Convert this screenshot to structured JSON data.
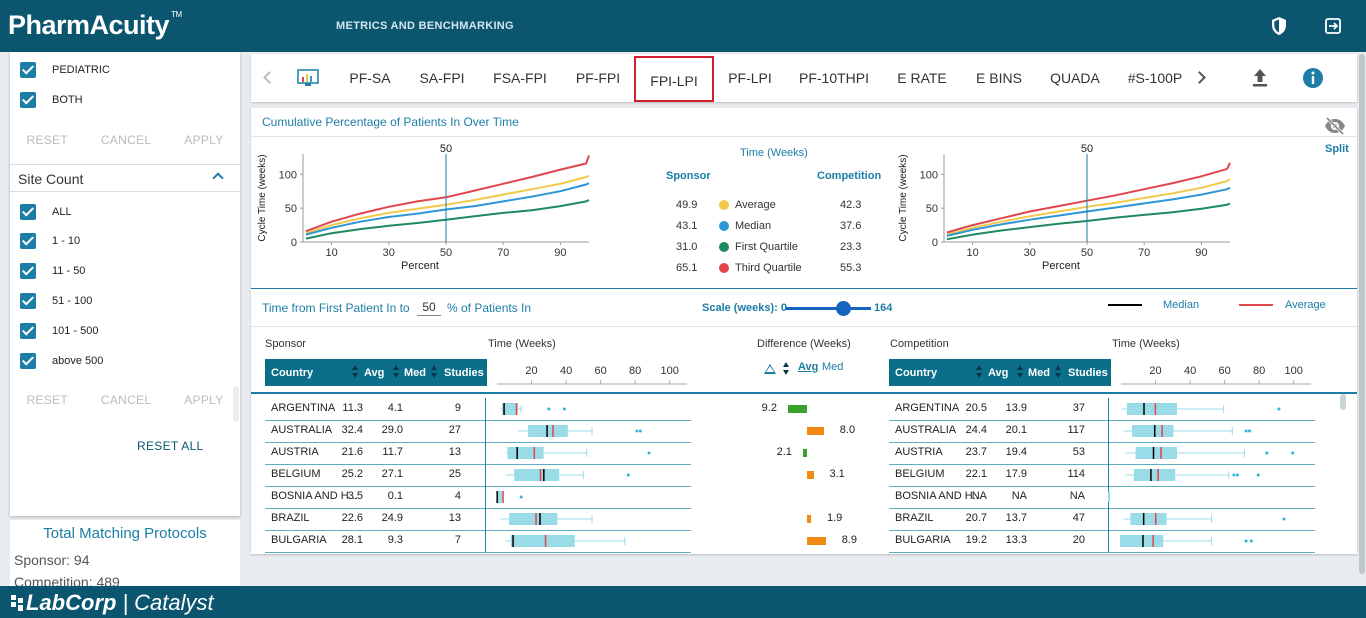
{
  "header": {
    "logo": "PharmAcuity",
    "logo_tm": "TM",
    "title": "METRICS AND BENCHMARKING",
    "icons": [
      "shield-icon",
      "logout-icon"
    ]
  },
  "sidebar": {
    "top_options": [
      {
        "label": "PEDIATRIC",
        "checked": true
      },
      {
        "label": "BOTH",
        "checked": true
      }
    ],
    "buttons": {
      "reset": "RESET",
      "cancel": "CANCEL",
      "apply": "APPLY"
    },
    "site_count": {
      "title": "Site Count",
      "options": [
        {
          "label": "ALL",
          "checked": true
        },
        {
          "label": "1 - 10",
          "checked": true
        },
        {
          "label": "11 - 50",
          "checked": true
        },
        {
          "label": "51 - 100",
          "checked": true
        },
        {
          "label": "101 - 500",
          "checked": true
        },
        {
          "label": "above 500",
          "checked": true
        }
      ]
    },
    "reset_all": "RESET ALL",
    "totals": {
      "title": "Total Matching Protocols",
      "sponsor": "Sponsor: 94",
      "competition": "Competition: 489"
    }
  },
  "tabs": {
    "items": [
      "PF-SA",
      "SA-FPI",
      "FSA-FPI",
      "PF-FPI",
      "FPI-LPI",
      "PF-LPI",
      "PF-10THPI",
      "E RATE",
      "E BINS",
      "QUADA",
      "#S-100P"
    ],
    "active": "FPI-LPI",
    "icons": [
      "chart-icon",
      "upload-icon",
      "info-icon"
    ]
  },
  "cumulative": {
    "title": "Cumulative Percentage of Patients In Over Time",
    "split_label": "Split",
    "legend_title": "Time (Weeks)",
    "sponsor_label": "Sponsor",
    "competition_label": "Competition",
    "legend": [
      {
        "name": "Average",
        "sponsor": "49.9",
        "competition": "42.3",
        "color": "#f1c94a"
      },
      {
        "name": "Median",
        "sponsor": "43.1",
        "competition": "37.6",
        "color": "#2f96d6"
      },
      {
        "name": "First Quartile",
        "sponsor": "31.0",
        "competition": "23.3",
        "color": "#1e8a5e"
      },
      {
        "name": "Third Quartile",
        "sponsor": "65.1",
        "competition": "55.3",
        "color": "#e0464c"
      }
    ]
  },
  "chart_data": [
    {
      "type": "line",
      "title": "",
      "xlabel": "Percent",
      "ylabel": "Cycle Time (weeks)",
      "x_ticks": [
        "10",
        "30",
        "50",
        "70",
        "90"
      ],
      "y_ticks": [
        "0",
        "50",
        "100"
      ],
      "xlim": [
        0,
        100
      ],
      "ylim": [
        0,
        130
      ],
      "marker": {
        "x": 50,
        "label": "50"
      },
      "x": [
        1,
        10,
        20,
        30,
        40,
        50,
        60,
        70,
        80,
        90,
        99,
        100
      ],
      "series": [
        {
          "name": "Third Quartile",
          "color": "#e0464c",
          "values": [
            16,
            30,
            42,
            52,
            60,
            66,
            76,
            86,
            96,
            107,
            116,
            128
          ]
        },
        {
          "name": "Average",
          "color": "#f1c94a",
          "values": [
            13,
            25,
            35,
            43,
            49,
            55,
            62,
            70,
            78,
            86,
            96,
            98
          ]
        },
        {
          "name": "Median",
          "color": "#2f96d6",
          "values": [
            11,
            21,
            30,
            37,
            42,
            48,
            53,
            60,
            67,
            75,
            85,
            87
          ]
        },
        {
          "name": "First Quartile",
          "color": "#1e8a5e",
          "values": [
            5,
            13,
            19,
            24,
            28,
            33,
            38,
            43,
            47,
            53,
            60,
            62
          ]
        }
      ]
    },
    {
      "type": "line",
      "title": "",
      "xlabel": "Percent",
      "ylabel": "Cycle Time (weeks)",
      "x_ticks": [
        "10",
        "30",
        "50",
        "70",
        "90"
      ],
      "y_ticks": [
        "0",
        "50",
        "100"
      ],
      "xlim": [
        0,
        100
      ],
      "ylim": [
        0,
        130
      ],
      "marker": {
        "x": 50,
        "label": "50"
      },
      "x": [
        1,
        10,
        20,
        30,
        40,
        50,
        60,
        70,
        80,
        90,
        99,
        100
      ],
      "series": [
        {
          "name": "Third Quartile",
          "color": "#e0464c",
          "values": [
            14,
            25,
            35,
            45,
            53,
            61,
            69,
            78,
            87,
            97,
            108,
            117
          ]
        },
        {
          "name": "Average",
          "color": "#f1c94a",
          "values": [
            11,
            21,
            30,
            38,
            45,
            52,
            58,
            65,
            72,
            80,
            90,
            93
          ]
        },
        {
          "name": "Median",
          "color": "#2f96d6",
          "values": [
            9,
            18,
            26,
            33,
            39,
            45,
            51,
            57,
            63,
            70,
            78,
            80
          ]
        },
        {
          "name": "First Quartile",
          "color": "#1e8a5e",
          "values": [
            4,
            11,
            17,
            22,
            27,
            31,
            36,
            40,
            44,
            49,
            55,
            57
          ]
        }
      ]
    },
    {
      "type": "table",
      "title": "Time from First Patient In to 50 % of Patients In",
      "columns": [
        "Country",
        "Avg",
        "Med",
        "Studies"
      ],
      "sponsor": [
        {
          "country": "ARGENTINA",
          "avg": "11.3",
          "med": "4.1",
          "studies": "9"
        },
        {
          "country": "AUSTRALIA",
          "avg": "32.4",
          "med": "29.0",
          "studies": "27"
        },
        {
          "country": "AUSTRIA",
          "avg": "21.6",
          "med": "11.7",
          "studies": "13"
        },
        {
          "country": "BELGIUM",
          "avg": "25.2",
          "med": "27.1",
          "studies": "25"
        },
        {
          "country": "BOSNIA AND H...",
          "avg": "3.5",
          "med": "0.1",
          "studies": "4"
        },
        {
          "country": "BRAZIL",
          "avg": "22.6",
          "med": "24.9",
          "studies": "13"
        },
        {
          "country": "BULGARIA",
          "avg": "28.1",
          "med": "9.3",
          "studies": "7"
        }
      ],
      "competition": [
        {
          "country": "ARGENTINA",
          "avg": "20.5",
          "med": "13.9",
          "studies": "37"
        },
        {
          "country": "AUSTRALIA",
          "avg": "24.4",
          "med": "20.1",
          "studies": "117"
        },
        {
          "country": "AUSTRIA",
          "avg": "23.7",
          "med": "19.4",
          "studies": "53"
        },
        {
          "country": "BELGIUM",
          "avg": "22.1",
          "med": "17.9",
          "studies": "114"
        },
        {
          "country": "BOSNIA AND H...",
          "avg": "NA",
          "med": "NA",
          "studies": "NA"
        },
        {
          "country": "BRAZIL",
          "avg": "20.7",
          "med": "13.7",
          "studies": "47"
        },
        {
          "country": "BULGARIA",
          "avg": "19.2",
          "med": "13.3",
          "studies": "20"
        }
      ],
      "difference": [
        {
          "value": "9.2",
          "direction": "left",
          "color": "#3aa12f"
        },
        {
          "value": "8.0",
          "direction": "right",
          "color": "#f28b13"
        },
        {
          "value": "2.1",
          "direction": "left",
          "color": "#3aa12f"
        },
        {
          "value": "3.1",
          "direction": "right",
          "color": "#f28b13"
        },
        {
          "value": "",
          "direction": "none",
          "color": ""
        },
        {
          "value": "1.9",
          "direction": "right",
          "color": "#f28b13"
        },
        {
          "value": "8.9",
          "direction": "right",
          "color": "#f28b13"
        }
      ],
      "sponsor_boxes": [
        {
          "q1": 3,
          "q3": 12,
          "med": 4.1,
          "avg": 11.3,
          "wl": 2,
          "wh": 14,
          "out": [
            30,
            39
          ]
        },
        {
          "q1": 18,
          "q3": 41,
          "med": 29.0,
          "avg": 32.4,
          "wl": 12,
          "wh": 55,
          "out": [
            81,
            83
          ]
        },
        {
          "q1": 6,
          "q3": 27,
          "med": 11.7,
          "avg": 21.6,
          "wl": 5,
          "wh": 52,
          "out": [
            88
          ]
        },
        {
          "q1": 10,
          "q3": 36,
          "med": 27.1,
          "avg": 25.2,
          "wl": 5,
          "wh": 50,
          "out": [
            76
          ]
        },
        {
          "q1": 0,
          "q3": 3,
          "med": 0.1,
          "avg": 3.5,
          "wl": 0,
          "wh": 3,
          "out": [
            14
          ]
        },
        {
          "q1": 7,
          "q3": 35,
          "med": 24.9,
          "avg": 22.6,
          "wl": 2,
          "wh": 55,
          "out": []
        },
        {
          "q1": 8,
          "q3": 45,
          "med": 9.3,
          "avg": 28.1,
          "wl": 5,
          "wh": 74,
          "out": []
        }
      ],
      "competition_boxes": [
        {
          "q1": 4,
          "q3": 33,
          "med": 13.9,
          "avg": 20.5,
          "wl": 1,
          "wh": 60,
          "out": [
            92
          ]
        },
        {
          "q1": 7,
          "q3": 31,
          "med": 20.1,
          "avg": 24.4,
          "wl": 2,
          "wh": 65,
          "out": [
            73,
            75
          ]
        },
        {
          "q1": 9,
          "q3": 33,
          "med": 19.4,
          "avg": 23.7,
          "wl": 3,
          "wh": 72,
          "out": [
            85,
            100
          ]
        },
        {
          "q1": 8,
          "q3": 32,
          "med": 17.9,
          "avg": 22.1,
          "wl": 3,
          "wh": 63,
          "out": [
            66,
            68,
            80
          ]
        },
        {
          "q1": 0,
          "q3": 0,
          "med": 0,
          "avg": 0,
          "wl": 0,
          "wh": 0,
          "out": []
        },
        {
          "q1": 6,
          "q3": 27,
          "med": 13.7,
          "avg": 20.7,
          "wl": 2,
          "wh": 53,
          "out": [
            95
          ]
        },
        {
          "q1": 0,
          "q3": 25,
          "med": 13.3,
          "avg": 19.2,
          "wl": 0,
          "wh": 53,
          "out": [
            73,
            76
          ]
        }
      ],
      "time_ticks": [
        "20",
        "40",
        "60",
        "80",
        "100"
      ],
      "time_range": [
        0,
        110
      ]
    }
  ],
  "controls": {
    "label_prefix": "Time from First Patient In to",
    "percent": "50",
    "label_suffix": "% of Patients In",
    "scale_label": "Scale (weeks): 0",
    "scale_max": "164",
    "scale_value": 0.65,
    "median_label": "Median",
    "average_label": "Average",
    "median_color": "#000000",
    "average_color": "#e0464c"
  },
  "table": {
    "sponsor_label": "Sponsor",
    "competition_label": "Competition",
    "time_label": "Time (Weeks)",
    "difference_label": "Difference (Weeks)",
    "col_country": "Country",
    "col_avg": "Avg",
    "col_med": "Med",
    "col_studies": "Studies",
    "diff_avg": "Avg",
    "diff_med": "Med"
  },
  "footer": {
    "brand": "LabCorp",
    "product": "Catalyst"
  }
}
